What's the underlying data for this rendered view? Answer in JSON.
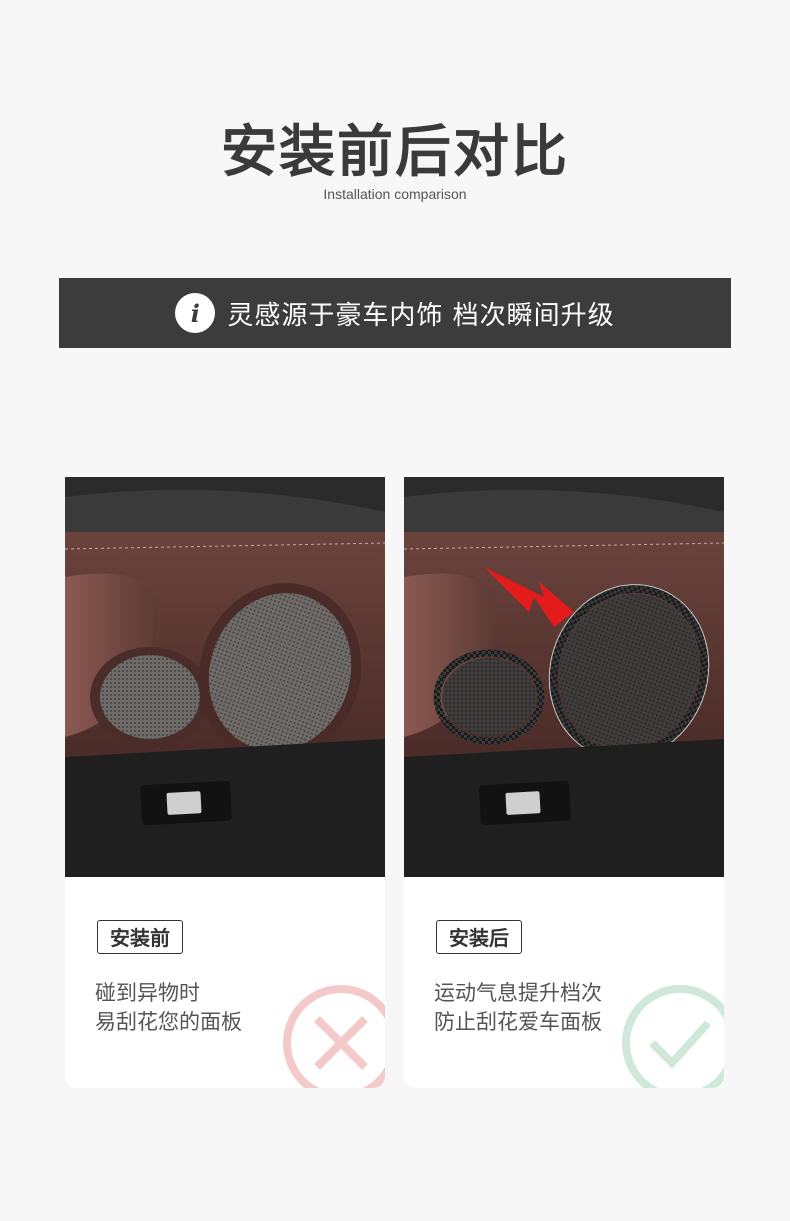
{
  "header": {
    "title": "安装前后对比",
    "subtitle": "Installation comparison"
  },
  "banner": {
    "icon": "info-icon",
    "icon_glyph": "i",
    "text": "灵感源于豪车内饰 档次瞬间升级"
  },
  "cards": [
    {
      "tag": "安装前",
      "lines": [
        "碰到异物时",
        "易刮花您的面板"
      ],
      "mark_icon": "cross-icon",
      "mark_color": "#f4c9c9"
    },
    {
      "tag": "安装后",
      "lines": [
        "运动气息提升档次",
        "防止刮花爱车面板"
      ],
      "mark_icon": "check-icon",
      "mark_color": "#cfe8d9"
    }
  ],
  "colors": {
    "banner_bg": "#3c3c3c",
    "leather": "#5a3530",
    "arrow": "#e41b1b"
  }
}
